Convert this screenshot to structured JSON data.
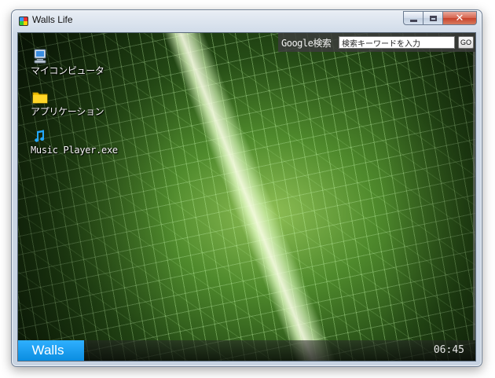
{
  "window": {
    "title": "Walls Life",
    "minimize_icon": "minimize-icon",
    "maximize_icon": "maximize-icon",
    "close_icon": "close-icon",
    "close_glyph": "✕"
  },
  "search": {
    "label": "Google検索",
    "placeholder": "検索キーワードを入力",
    "value": "検索キーワードを入力",
    "button_label": "GO"
  },
  "desktop_icons": [
    {
      "label": "マイコンピュータ",
      "icon": "computer-icon"
    },
    {
      "label": "アプリケーション",
      "icon": "folder-icon"
    },
    {
      "label": "Music Player.exe",
      "icon": "music-note-icon"
    }
  ],
  "taskbar": {
    "start_label": "Walls",
    "clock": "06:45",
    "accent_color": "#1aa0f0"
  }
}
